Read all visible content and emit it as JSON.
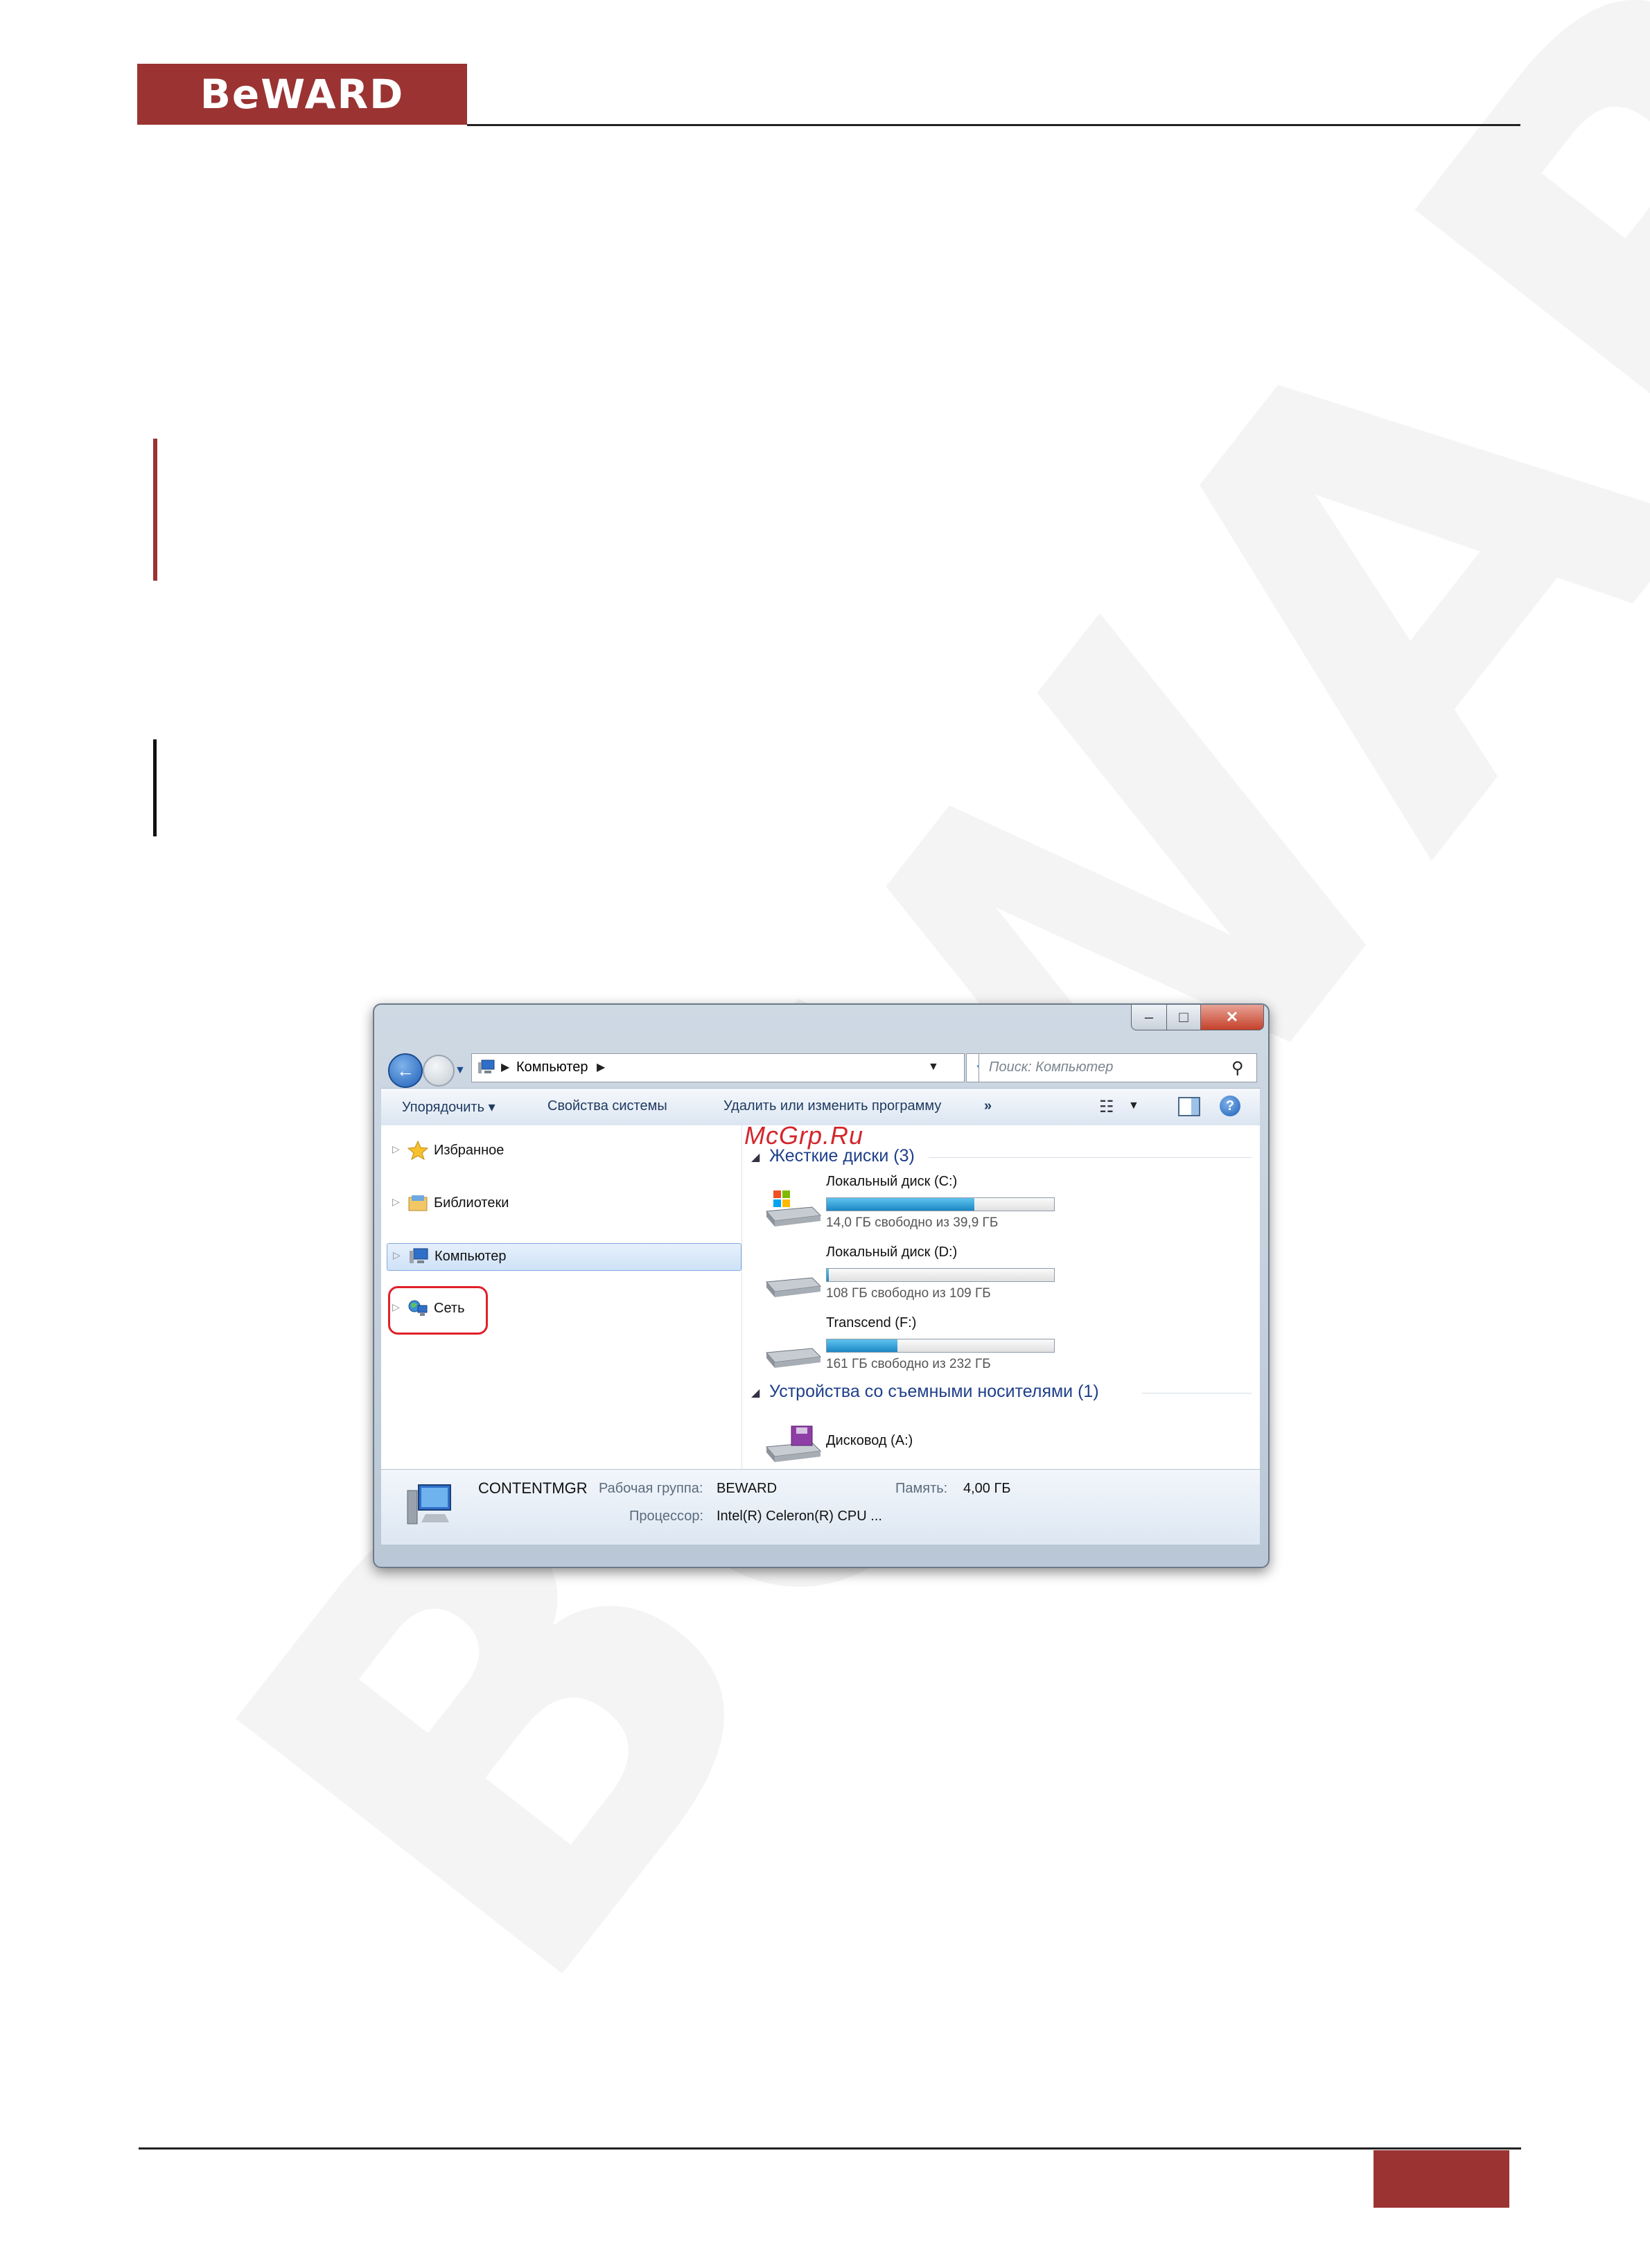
{
  "header": {
    "logo": "BeWARD"
  },
  "explorer": {
    "window_buttons": {
      "minimize": "–",
      "maximize": "□",
      "close": "✕"
    },
    "address": {
      "path": "Компьютер"
    },
    "search": {
      "placeholder": "Поиск: Компьютер"
    },
    "toolbar": {
      "organize": "Упорядочить ▾",
      "system_properties": "Свойства системы",
      "uninstall": "Удалить или изменить программу",
      "more": "»",
      "help": "?"
    },
    "nav": {
      "favorites": "Избранное",
      "libraries": "Библиотеки",
      "computer": "Компьютер",
      "network": "Сеть"
    },
    "overlay_watermark": "McGrp.Ru",
    "groups": {
      "hdd": {
        "title": "Жесткие диски (3)"
      },
      "removable": {
        "title": "Устройства со съемными носителями (1)"
      }
    },
    "drives": [
      {
        "name": "Локальный диск (C:)",
        "free_text": "14,0 ГБ свободно из 39,9 ГБ",
        "used_fraction": 0.65
      },
      {
        "name": "Локальный диск (D:)",
        "free_text": "108 ГБ свободно из 109 ГБ",
        "used_fraction": 0.01
      },
      {
        "name": "Transcend (F:)",
        "free_text": "161 ГБ свободно из 232 ГБ",
        "used_fraction": 0.31
      }
    ],
    "removable_drive": {
      "name": "Дисковод (A:)"
    },
    "details": {
      "computer_name": "CONTENTMGR",
      "workgroup_label": "Рабочая группа:",
      "workgroup_value": "BEWARD",
      "memory_label": "Память:",
      "memory_value": "4,00 ГБ",
      "cpu_label": "Процессор:",
      "cpu_value": "Intel(R) Celeron(R) CPU ..."
    }
  },
  "colors": {
    "brand": "#9b3333",
    "highlight": "#e0202a",
    "group_title": "#1e3f8a"
  }
}
